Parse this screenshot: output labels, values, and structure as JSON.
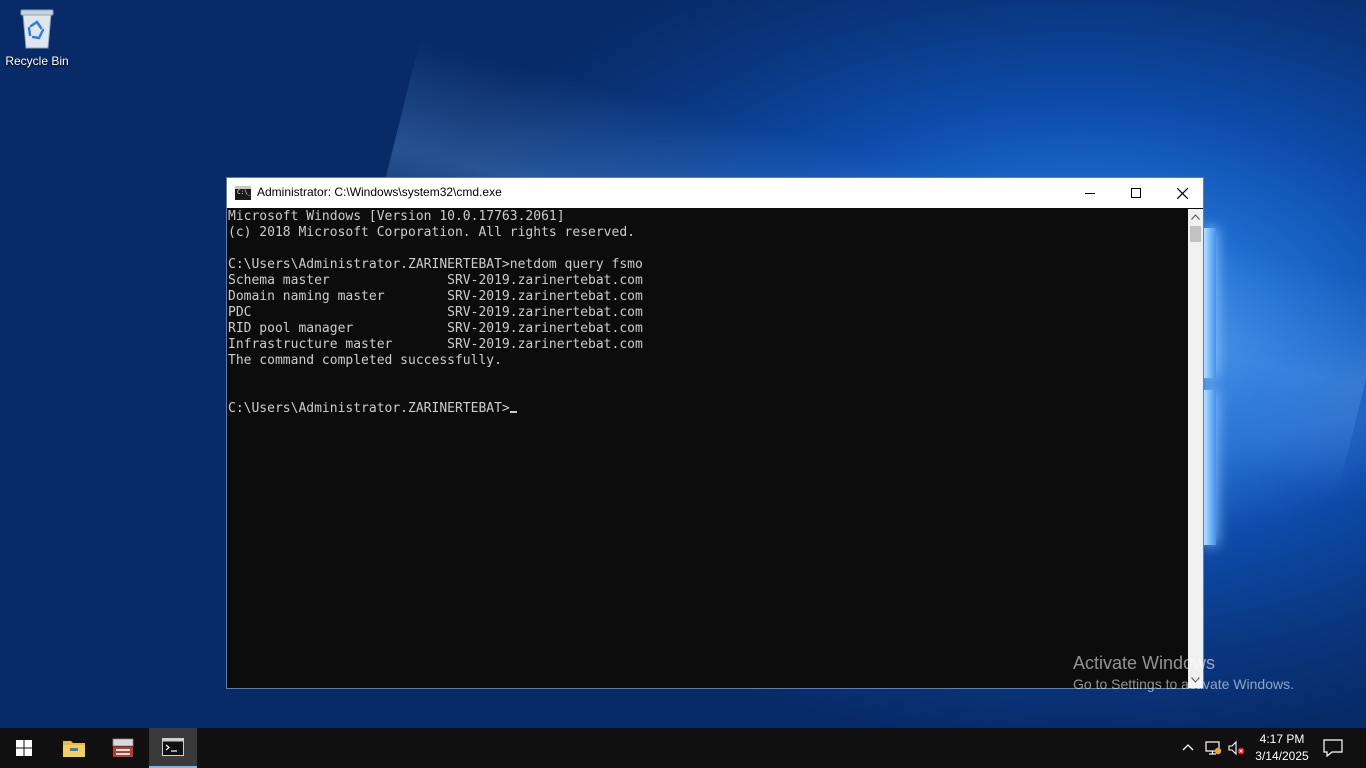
{
  "desktop": {
    "icons": [
      {
        "label": "Recycle Bin",
        "icon": "recycle-bin-icon"
      }
    ]
  },
  "window": {
    "title": "Administrator: C:\\Windows\\system32\\cmd.exe",
    "icon": "cmd-icon",
    "controls": [
      "minimize-icon",
      "maximize-icon",
      "close-icon"
    ]
  },
  "console": {
    "lines": [
      "Microsoft Windows [Version 10.0.17763.2061]",
      "(c) 2018 Microsoft Corporation. All rights reserved.",
      "",
      "C:\\Users\\Administrator.ZARINERTEBAT>netdom query fsmo",
      "Schema master               SRV-2019.zarinertebat.com",
      "Domain naming master        SRV-2019.zarinertebat.com",
      "PDC                         SRV-2019.zarinertebat.com",
      "RID pool manager            SRV-2019.zarinertebat.com",
      "Infrastructure master       SRV-2019.zarinertebat.com",
      "The command completed successfully.",
      "",
      "",
      "C:\\Users\\Administrator.ZARINERTEBAT>"
    ]
  },
  "watermark": {
    "title": "Activate Windows",
    "subtitle": "Go to Settings to activate Windows."
  },
  "taskbar": {
    "pinned": [
      "windows-start-icon",
      "file-explorer-icon",
      "server-manager-icon",
      "command-prompt-icon"
    ],
    "active": "command-prompt-icon",
    "tray_icons": [
      "chevron-up-icon",
      "network-icon",
      "volume-muted-icon"
    ],
    "time": "4:17 PM",
    "date": "3/14/2025",
    "notification_icon": "action-center-icon"
  },
  "colors": {
    "console_bg": "#0c0c0c",
    "console_text": "#cccccc",
    "taskbar_bg": "#101010",
    "accent": "#76b9ed"
  }
}
